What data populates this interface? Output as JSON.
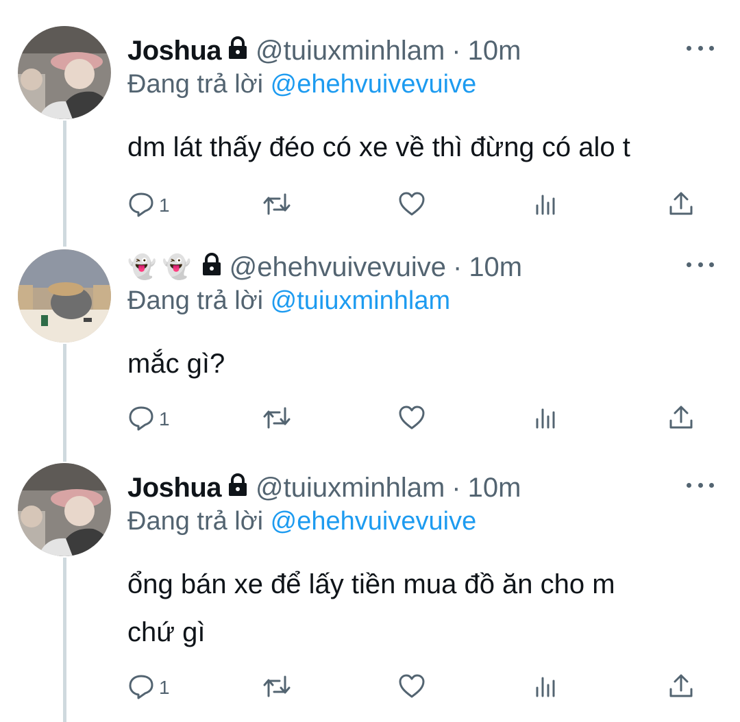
{
  "replying_prefix": "Đang trả lời",
  "tweets": [
    {
      "name": "Joshua",
      "handle": "@tuiuxminhlam",
      "dot": "·",
      "time": "10m",
      "replying_to": "@ehehvuivevuive",
      "text_lines": [
        "dm lát thấy đéo có xe về thì đừng có alo t"
      ],
      "reply_count": "1"
    },
    {
      "name": "👻 👻",
      "handle": "@ehehvuivevuive",
      "dot": "·",
      "time": "10m",
      "replying_to": "@tuiuxminhlam",
      "text_lines": [
        "mắc gì?"
      ],
      "reply_count": "1"
    },
    {
      "name": "Joshua",
      "handle": "@tuiuxminhlam",
      "dot": "·",
      "time": "10m",
      "replying_to": "@ehehvuivevuive",
      "text_lines": [
        "ổng bán xe để lấy tiền mua đồ ăn cho m",
        "chứ gì"
      ],
      "reply_count": "1"
    }
  ],
  "icons": {
    "lock": "lock-icon",
    "more": "more-icon",
    "reply": "reply-icon",
    "retweet": "retweet-icon",
    "like": "like-icon",
    "views": "views-icon",
    "share": "share-icon"
  },
  "colors": {
    "accent": "#1d9bf0",
    "secondary_text": "#536471",
    "thread_line": "#cfd9de"
  }
}
